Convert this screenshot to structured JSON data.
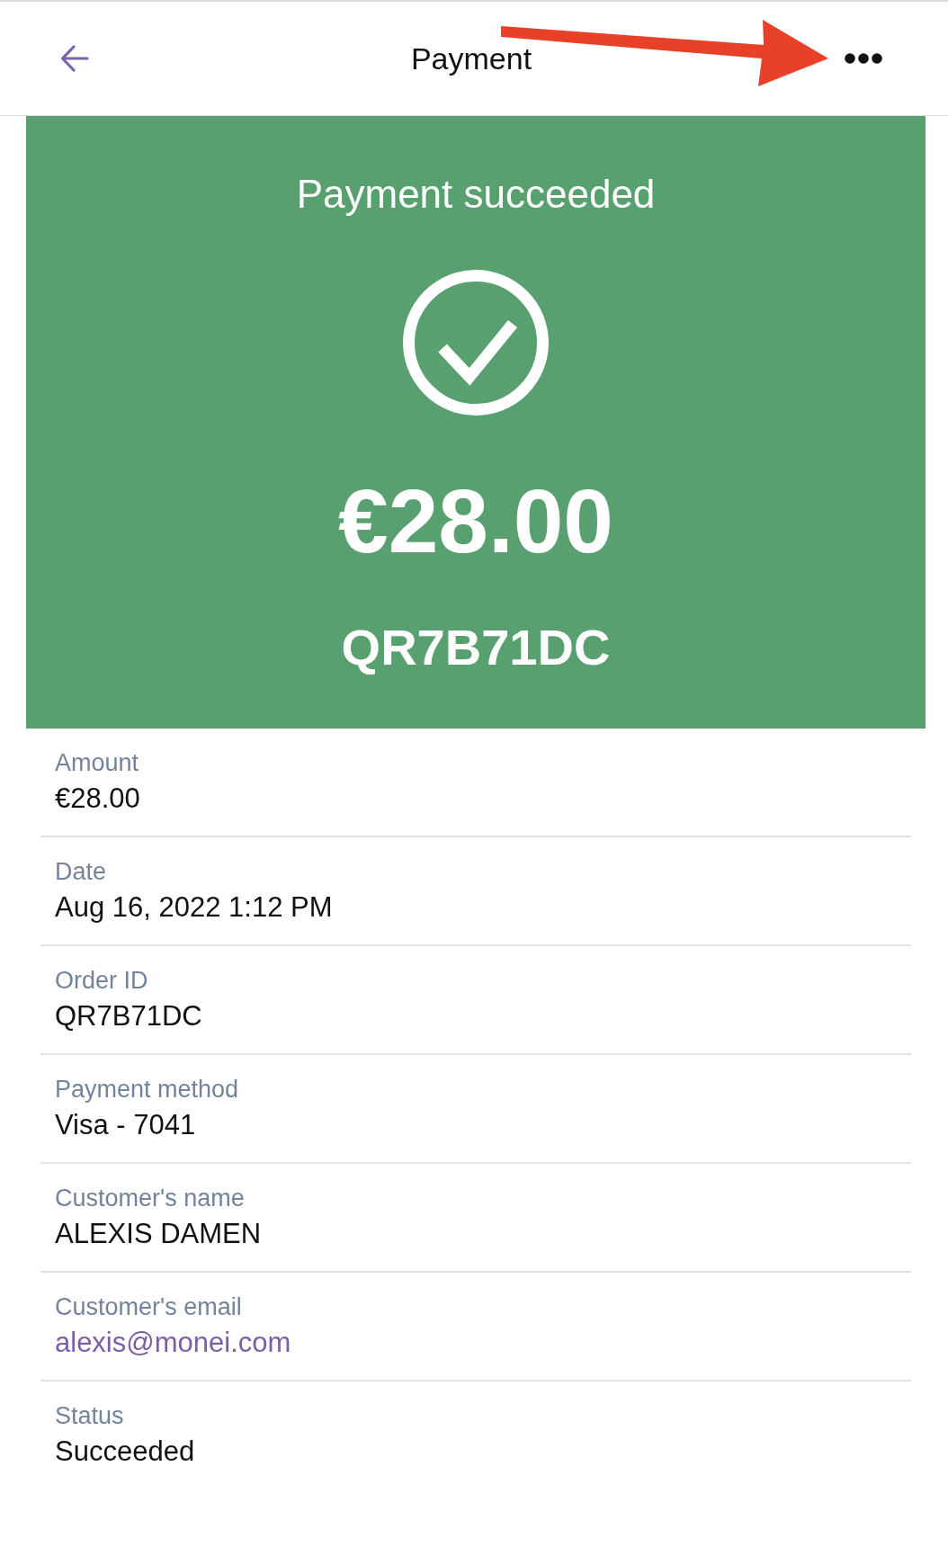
{
  "header": {
    "title": "Payment"
  },
  "summary": {
    "heading": "Payment succeeded",
    "amount": "€28.00",
    "reference": "QR7B71DC"
  },
  "details": [
    {
      "label": "Amount",
      "value": "€28.00",
      "kind": "text"
    },
    {
      "label": "Date",
      "value": "Aug 16, 2022 1:12 PM",
      "kind": "text"
    },
    {
      "label": "Order ID",
      "value": "QR7B71DC",
      "kind": "text"
    },
    {
      "label": "Payment method",
      "value": "Visa - 7041",
      "kind": "text"
    },
    {
      "label": "Customer's name",
      "value": "ALEXIS DAMEN",
      "kind": "text"
    },
    {
      "label": "Customer's email",
      "value": "alexis@monei.com",
      "kind": "link"
    },
    {
      "label": "Status",
      "value": "Succeeded",
      "kind": "text"
    }
  ]
}
